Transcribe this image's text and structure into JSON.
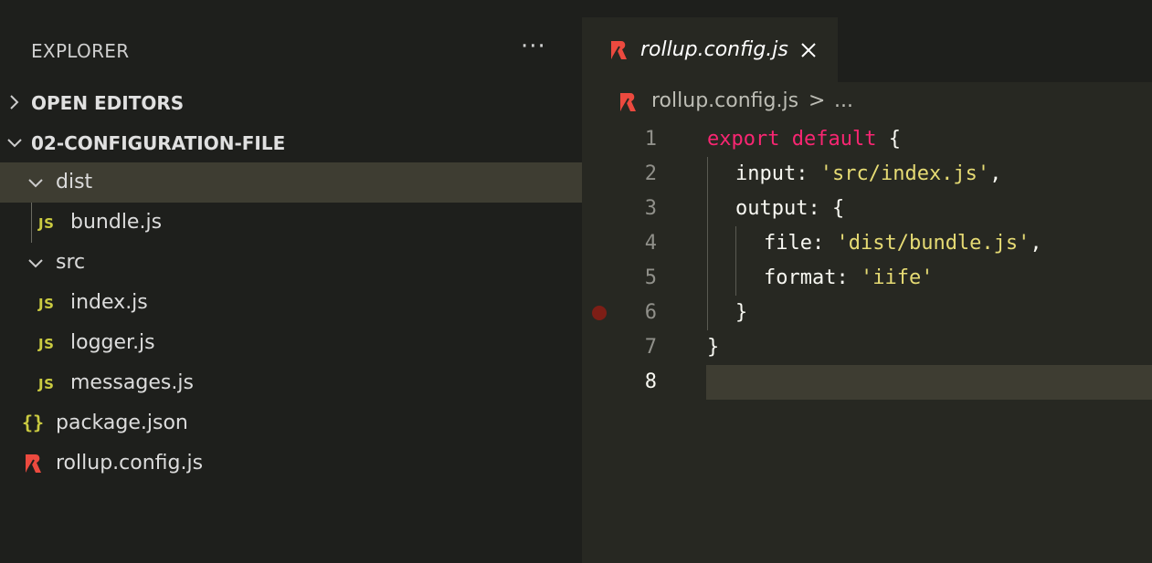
{
  "sidebar": {
    "title": "EXPLORER",
    "more_label": "···",
    "sections": {
      "open_editors": "OPEN EDITORS",
      "project": "02-CONFIGURATION-FILE"
    },
    "tree": {
      "dist": "dist",
      "bundle": "bundle.js",
      "src": "src",
      "index": "index.js",
      "logger": "logger.js",
      "messages": "messages.js",
      "package": "package.json",
      "rollup": "rollup.config.js"
    },
    "icons": {
      "js_label": "JS",
      "json_label": "{}"
    }
  },
  "editor": {
    "tab": {
      "label": "rollup.config.js"
    },
    "breadcrumb": {
      "file": "rollup.config.js",
      "separator": ">",
      "more": "..."
    },
    "lines": [
      {
        "num": "1",
        "kw1": "export",
        "kw2": "default",
        "punct": " {"
      },
      {
        "num": "2",
        "key": "input",
        "colon": ": ",
        "str": "'src/index.js'",
        "tail": ","
      },
      {
        "num": "3",
        "key": "output",
        "tail": ": {"
      },
      {
        "num": "4",
        "key": "file",
        "colon": ": ",
        "str": "'dist/bundle.js'",
        "tail": ","
      },
      {
        "num": "5",
        "key": "format",
        "colon": ": ",
        "str": "'iife'"
      },
      {
        "num": "6",
        "text": "}"
      },
      {
        "num": "7",
        "text": "}"
      },
      {
        "num": "8",
        "text": ""
      }
    ]
  },
  "colors": {
    "keyword": "#f92672",
    "string": "#e6db74",
    "js_icon": "#cbcb41",
    "rollup_icon": "#ec4a3f",
    "selection": "#3e3d32",
    "breakpoint": "#7d1e16"
  }
}
